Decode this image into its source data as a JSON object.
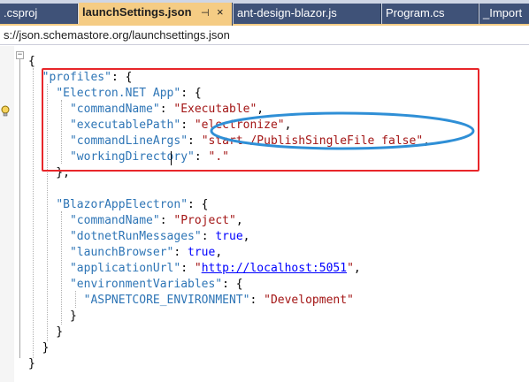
{
  "tabs": [
    {
      "label": ".csproj"
    },
    {
      "label": "launchSettings.json",
      "active": true
    },
    {
      "label": "ant-design-blazor.js"
    },
    {
      "label": "Program.cs"
    },
    {
      "label": "_Import"
    }
  ],
  "url": "s://json.schemastore.org/launchsettings.json",
  "code": {
    "l1": "{",
    "profiles_key": "\"profiles\"",
    "electron_key": "\"Electron.NET App\"",
    "cn_key": "\"commandName\"",
    "cn_val": "\"Executable\"",
    "ep_key_a": "\"executable",
    "ep_key_b": "Path\"",
    "ep_val": "\"electronize\"",
    "cla_key": "\"commandLineArgs\"",
    "cla_val": "\"start /PublishSingleFile false\"",
    "wd_key": "\"workingDirectory\"",
    "wd_val": "\".\"",
    "blazor_key": "\"BlazorAppElectron\"",
    "cn2_val": "\"Project\"",
    "drm_key": "\"dotnetRunMessages\"",
    "true1": "true",
    "lb_key": "\"launchBrowser\"",
    "true2": "true",
    "au_key": "\"applicationUrl\"",
    "au_val": "http://localhost:5051",
    "ev_key": "\"environmentVariables\"",
    "asp_key": "\"ASPNETCORE_ENVIRONMENT\"",
    "asp_val": "\"Development\""
  },
  "colors": {
    "key": "#2e75b6",
    "string": "#a31515",
    "keyword": "#0000ff",
    "highlight_box": "#e8262a",
    "highlight_ellipse": "#2f8fd6",
    "active_tab": "#f5cc84",
    "inactive_tab": "#3f5278"
  },
  "icons": [
    "pin-icon",
    "close-icon",
    "lightbulb-icon"
  ]
}
